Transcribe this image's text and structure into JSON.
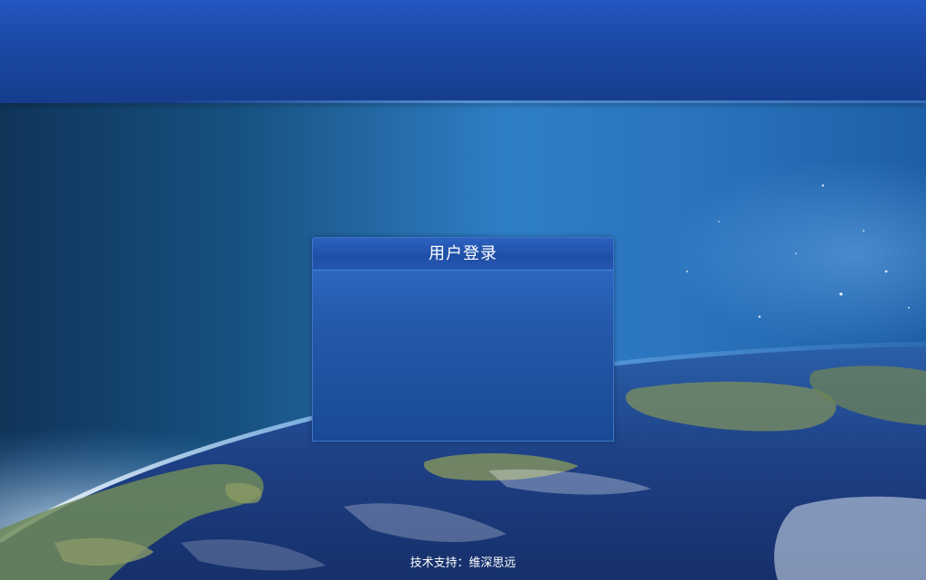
{
  "login": {
    "title": "用户登录"
  },
  "footer": {
    "support_text": "技术支持：维深思远"
  },
  "colors": {
    "header_band": "#1c4aa8",
    "panel_top": "#2f6fcd",
    "panel_bottom": "#1a4a96",
    "ocean": "#1d3f84",
    "land": "#7a8f5e"
  },
  "background": {
    "image": "earth-from-space"
  }
}
